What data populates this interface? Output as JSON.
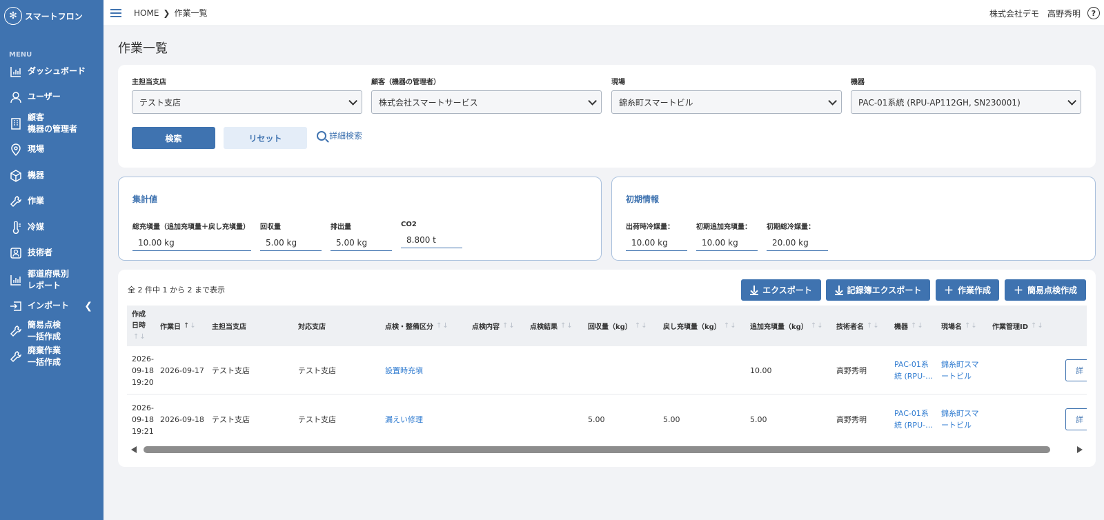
{
  "brand": {
    "name": "スマートフロン",
    "logo_icon": "snowflake-logo"
  },
  "sidebar": {
    "menu_label": "MENU",
    "items": [
      {
        "label": "ダッシュボード",
        "icon": "bar-chart-icon"
      },
      {
        "label": "ユーザー",
        "icon": "user-icon"
      },
      {
        "label": "顧客\n機器の管理者",
        "icon": "building-icon"
      },
      {
        "label": "現場",
        "icon": "map-pin-icon"
      },
      {
        "label": "機器",
        "icon": "box-icon"
      },
      {
        "label": "作業",
        "icon": "wrench-icon"
      },
      {
        "label": "冷媒",
        "icon": "thermometer-icon"
      },
      {
        "label": "技術者",
        "icon": "id-card-icon"
      },
      {
        "label": "都道府県別\nレポート",
        "icon": "bar-chart-icon"
      },
      {
        "label": "インポート",
        "icon": "import-icon"
      },
      {
        "label": "簡易点検\n一括作成",
        "icon": "wrench-icon"
      },
      {
        "label": "廃棄作業\n一括作成",
        "icon": "wrench-icon"
      }
    ]
  },
  "topbar": {
    "breadcrumb_home": "HOME",
    "breadcrumb_current": "作業一覧",
    "company": "株式会社デモ",
    "user": "高野秀明",
    "help": "?"
  },
  "page": {
    "title": "作業一覧"
  },
  "search": {
    "fields": [
      {
        "label": "主担当支店",
        "value": "テスト支店"
      },
      {
        "label": "顧客（機器の管理者）",
        "value": "株式会社スマートサービス"
      },
      {
        "label": "現場",
        "value": "錦糸町スマートビル"
      },
      {
        "label": "機器",
        "value": "PAC-01系統 (RPU-AP112GH, SN230001)"
      }
    ],
    "search_button": "検索",
    "reset_button": "リセット",
    "advanced_link": "詳細検索"
  },
  "totals": {
    "title": "集計値",
    "fields": [
      {
        "label": "総充塡量（追加充塡量＋戻し充塡量）",
        "value": "10.00 kg"
      },
      {
        "label": "回収量",
        "value": "5.00 kg"
      },
      {
        "label": "排出量",
        "value": "5.00 kg"
      },
      {
        "label": "CO2",
        "value": "8.800 t"
      }
    ]
  },
  "initial": {
    "title": "初期情報",
    "fields": [
      {
        "label": "出荷時冷媒量：",
        "value": "10.00 kg"
      },
      {
        "label": "初期追加充塡量：",
        "value": "10.00 kg"
      },
      {
        "label": "初期総冷媒量：",
        "value": "20.00 kg"
      }
    ]
  },
  "table": {
    "count_text": "全 2 件中 1 から 2 まで表示",
    "actions": {
      "export": "エクスポート",
      "record_export": "記録簿エクスポート",
      "create_work": "作業作成",
      "create_simple": "簡易点検作成"
    },
    "headers": {
      "created_1": "作成",
      "created_2": "日時",
      "work_date": "作業日",
      "main_branch": "主担当支店",
      "branch": "対応支店",
      "category": "点検・整備区分",
      "content": "点検内容",
      "result": "点検結果",
      "recovered": "回収量（kg）",
      "returned": "戻し充塡量（kg）",
      "added": "追加充塡量（kg）",
      "technician": "技術者名",
      "equipment": "機器",
      "site": "現場名",
      "work_id": "作業管理ID"
    },
    "rows": [
      {
        "created": "2026-\n09-18\n19:20",
        "work_date": "2026-09-17",
        "main_branch": "テスト支店",
        "branch": "テスト支店",
        "category": "設置時充塡",
        "content": "",
        "result": "",
        "recovered": "",
        "returned": "",
        "added": "10.00",
        "technician": "高野秀明",
        "equipment": "PAC-01系\n統 (RPU-…",
        "site": "錦糸町スマ\nートビル",
        "work_id": "",
        "detail": "詳"
      },
      {
        "created": "2026-\n09-18\n19:21",
        "work_date": "2026-09-18",
        "main_branch": "テスト支店",
        "branch": "テスト支店",
        "category": "漏えい修理",
        "content": "",
        "result": "",
        "recovered": "5.00",
        "returned": "5.00",
        "added": "5.00",
        "technician": "高野秀明",
        "equipment": "PAC-01系\n統 (RPU-…",
        "site": "錦糸町スマ\nートビル",
        "work_id": "",
        "detail": "詳"
      }
    ]
  },
  "colors": {
    "primary": "#3f73b0",
    "link": "#2f7bd0",
    "background": "#f2f3f6"
  }
}
